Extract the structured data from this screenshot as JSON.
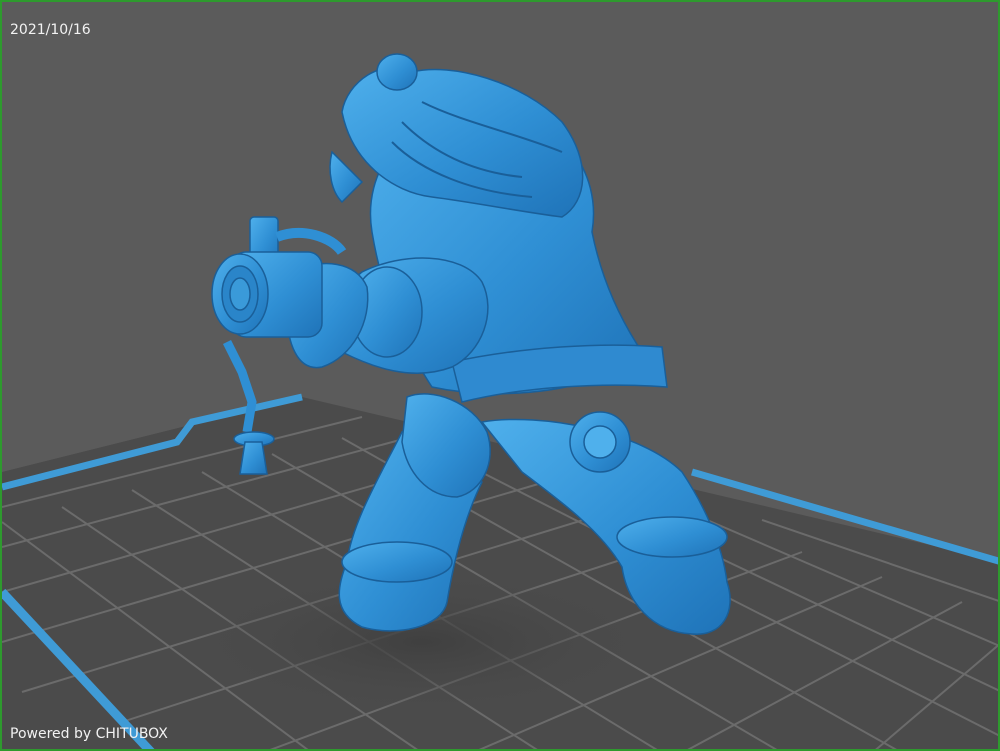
{
  "viewport": {
    "date_stamp": "2021/10/16",
    "powered_by": "Powered by CHITUBOX"
  },
  "colors": {
    "background": "#5b5b5b",
    "grid_plate": "#4a4a4a",
    "grid_lines": "#6e6e6e",
    "plate_border": "#3f9bd6",
    "model": "#3a9ad9",
    "frame": "#2e9a2e"
  },
  "model": {
    "icon": "3d-figure-model"
  }
}
